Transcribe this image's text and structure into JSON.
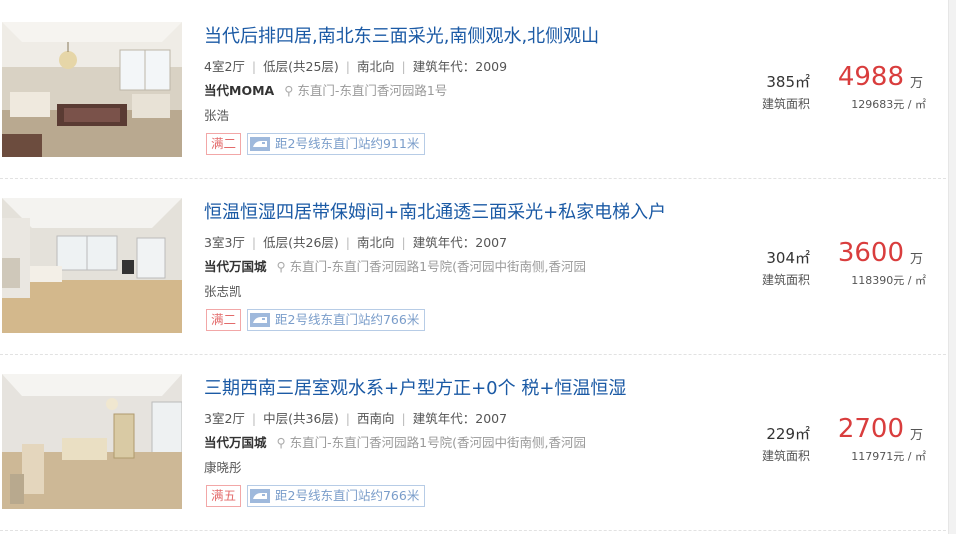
{
  "listings": [
    {
      "title": "当代后排四居,南北东三面采光,南侧观水,北侧观山",
      "layout": "4室2厅",
      "floor": "低层(共25层)",
      "orientation": "南北向",
      "year": "建筑年代：2009",
      "community": "当代MOMA",
      "address": "东直门-东直门香河园路1号",
      "agent": "张浩",
      "tax_tag": "满二",
      "metro_tag": "距2号线东直门站约911米",
      "area": "385㎡",
      "area_label": "建筑面积",
      "total_price": "4988",
      "price_unit": "万",
      "unit_price": "129683元 / ㎡"
    },
    {
      "title": "恒温恒湿四居带保姆间+南北通透三面采光+私家电梯入户",
      "layout": "3室3厅",
      "floor": "低层(共26层)",
      "orientation": "南北向",
      "year": "建筑年代：2007",
      "community": "当代万国城",
      "address": "东直门-东直门香河园路1号院(香河园中街南侧,香河园",
      "agent": "张志凯",
      "tax_tag": "满二",
      "metro_tag": "距2号线东直门站约766米",
      "area": "304㎡",
      "area_label": "建筑面积",
      "total_price": "3600",
      "price_unit": "万",
      "unit_price": "118390元 / ㎡"
    },
    {
      "title": "三期西南三居室观水系+户型方正+0个 税+恒温恒湿",
      "layout": "3室2厅",
      "floor": "中层(共36层)",
      "orientation": "西南向",
      "year": "建筑年代：2007",
      "community": "当代万国城",
      "address": "东直门-东直门香河园路1号院(香河园中街南侧,香河园",
      "agent": "康晓彤",
      "tax_tag": "满五",
      "metro_tag": "距2号线东直门站约766米",
      "area": "229㎡",
      "area_label": "建筑面积",
      "total_price": "2700",
      "price_unit": "万",
      "unit_price": "117971元 / ㎡"
    }
  ],
  "icons": {
    "location": "location-pin-icon",
    "metro": "metro-train-icon"
  },
  "colors": {
    "title": "#1b5aa5",
    "price": "#d93d3d",
    "tax_tag": "#e36b6b",
    "metro_tag": "#7a9dca"
  }
}
